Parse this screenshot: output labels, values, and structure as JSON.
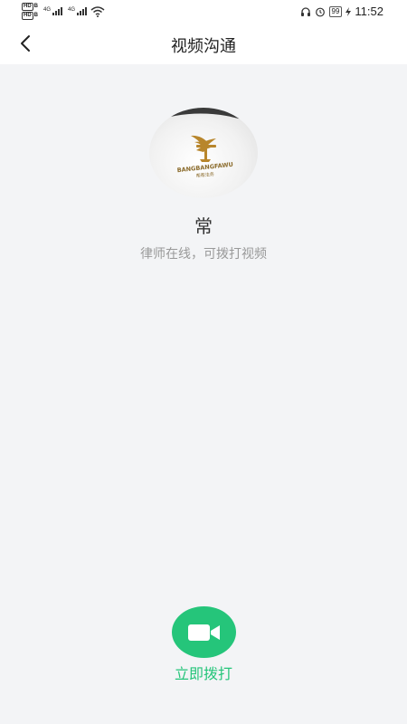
{
  "status_bar": {
    "time": "11:52",
    "battery": "99",
    "network_left": "4G",
    "network_right": "4G",
    "hd_top": "HD",
    "hd_top_suffix": "B",
    "hd_bottom": "HD",
    "hd_bottom_suffix": "B"
  },
  "header": {
    "title": "视频沟通"
  },
  "lawyer": {
    "name": "常",
    "status": "律师在线，可拨打视频",
    "logo_brand": "BANGBANGFAWU",
    "logo_sub": "帮帮法务"
  },
  "call": {
    "label": "立即拨打"
  },
  "colors": {
    "accent": "#25c57a",
    "background": "#f3f4f6",
    "logo_gold": "#b8862c"
  },
  "icons": {
    "back": "chevron-left-icon",
    "call": "video-camera-icon"
  }
}
